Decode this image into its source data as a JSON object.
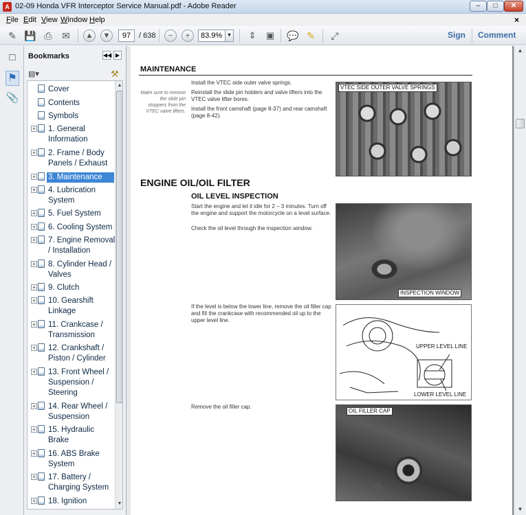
{
  "window": {
    "title": "02-09 Honda VFR Interceptor Service Manual.pdf - Adobe Reader",
    "app_icon": "adobe-reader-icon",
    "controls": {
      "minimize": "–",
      "maximize": "□",
      "close": "✕"
    }
  },
  "menu": {
    "items": [
      {
        "underline": "F",
        "rest": "ile"
      },
      {
        "underline": "E",
        "rest": "dit"
      },
      {
        "underline": "V",
        "rest": "iew"
      },
      {
        "underline": "W",
        "rest": "indow"
      },
      {
        "underline": "H",
        "rest": "elp"
      }
    ],
    "close_glyph": "×"
  },
  "toolbar": {
    "current_page": "97",
    "total_pages": "/ 638",
    "zoom": "83.9%",
    "sign_label": "Sign",
    "comment_label": "Comment"
  },
  "bookmarks": {
    "title": "Bookmarks",
    "items": [
      {
        "label": "Cover",
        "expandable": false
      },
      {
        "label": "Contents",
        "expandable": false
      },
      {
        "label": "Symbols",
        "expandable": false
      },
      {
        "label": "1. General Information",
        "expandable": true
      },
      {
        "label": "2. Frame / Body Panels / Exhaust",
        "expandable": true
      },
      {
        "label": "3. Maintenance",
        "expandable": true,
        "selected": true
      },
      {
        "label": "4. Lubrication System",
        "expandable": true
      },
      {
        "label": "5. Fuel System",
        "expandable": true
      },
      {
        "label": "6. Cooling System",
        "expandable": true
      },
      {
        "label": "7. Engine Removal / Installation",
        "expandable": true
      },
      {
        "label": "8. Cylinder Head / Valves",
        "expandable": true
      },
      {
        "label": "9. Clutch",
        "expandable": true
      },
      {
        "label": "10. Gearshift Linkage",
        "expandable": true
      },
      {
        "label": "11. Crankcase / Transmission",
        "expandable": true
      },
      {
        "label": "12. Crankshaft / Piston / Cylinder",
        "expandable": true
      },
      {
        "label": "13. Front Wheel / Suspension / Steering",
        "expandable": true
      },
      {
        "label": "14. Rear Wheel / Suspension",
        "expandable": true
      },
      {
        "label": "15. Hydraulic Brake",
        "expandable": true
      },
      {
        "label": "16. ABS Brake System",
        "expandable": true
      },
      {
        "label": "17. Battery / Charging System",
        "expandable": true
      },
      {
        "label": "18. Ignition",
        "expandable": true
      }
    ]
  },
  "document": {
    "section_header": "MAINTENANCE",
    "side_note": "Make sure to remove the slide pin stoppers from the VTEC valve lifters.",
    "steps_top": [
      "Install the VTEC side outer valve springs.",
      "Reinstall the slide pin holders and valve lifters into the VTEC valve lifter bores.",
      "Install the front camshaft (page 8-37) and rear camshaft (page 8-42)."
    ],
    "heading": "ENGINE OIL/OIL FILTER",
    "subheading": "OIL LEVEL INSPECTION",
    "para1": "Start the engine and let it idle for 2 – 3 minutes. Turn off the engine and support the motorcycle on a level surface.",
    "para2": "Check the oil level through the inspection window.",
    "para3": "If the level is below the lower line, remove the oil filler cap and fill the crankcase with recommended oil up to the upper level line.",
    "para4": "Remove the oil filler cap.",
    "fig1_label": "VTEC SIDE OUTER VALVE SPRINGS",
    "fig2_label": "INSPECTION WINDOW",
    "fig3_upper": "UPPER LEVEL LINE",
    "fig3_lower": "LOWER LEVEL LINE",
    "fig4_label": "OIL FILLER CAP"
  }
}
